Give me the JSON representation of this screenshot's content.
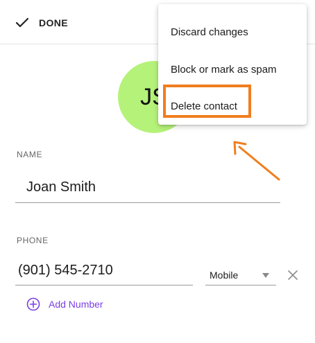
{
  "header": {
    "done_label": "DONE"
  },
  "avatar": {
    "initials": "JS",
    "color": "#b5f27a"
  },
  "name": {
    "label": "NAME",
    "value": "Joan Smith"
  },
  "phone": {
    "label": "PHONE",
    "value": "(901) 545-2710",
    "type": "Mobile",
    "add_label": "Add Number"
  },
  "menu": {
    "items": [
      {
        "label": "Discard changes"
      },
      {
        "label": "Block or mark as spam"
      },
      {
        "label": "Delete contact"
      }
    ]
  },
  "annotation": {
    "highlight_color": "#f07e1e",
    "target": "Delete contact"
  },
  "colors": {
    "accent": "#7b3fe4",
    "avatar": "#b5f27a",
    "annotation": "#f07e1e"
  },
  "icons": {
    "done": "checkmark-icon",
    "remove": "close-icon",
    "add": "add-circle-icon",
    "select": "dropdown-arrow-icon"
  }
}
